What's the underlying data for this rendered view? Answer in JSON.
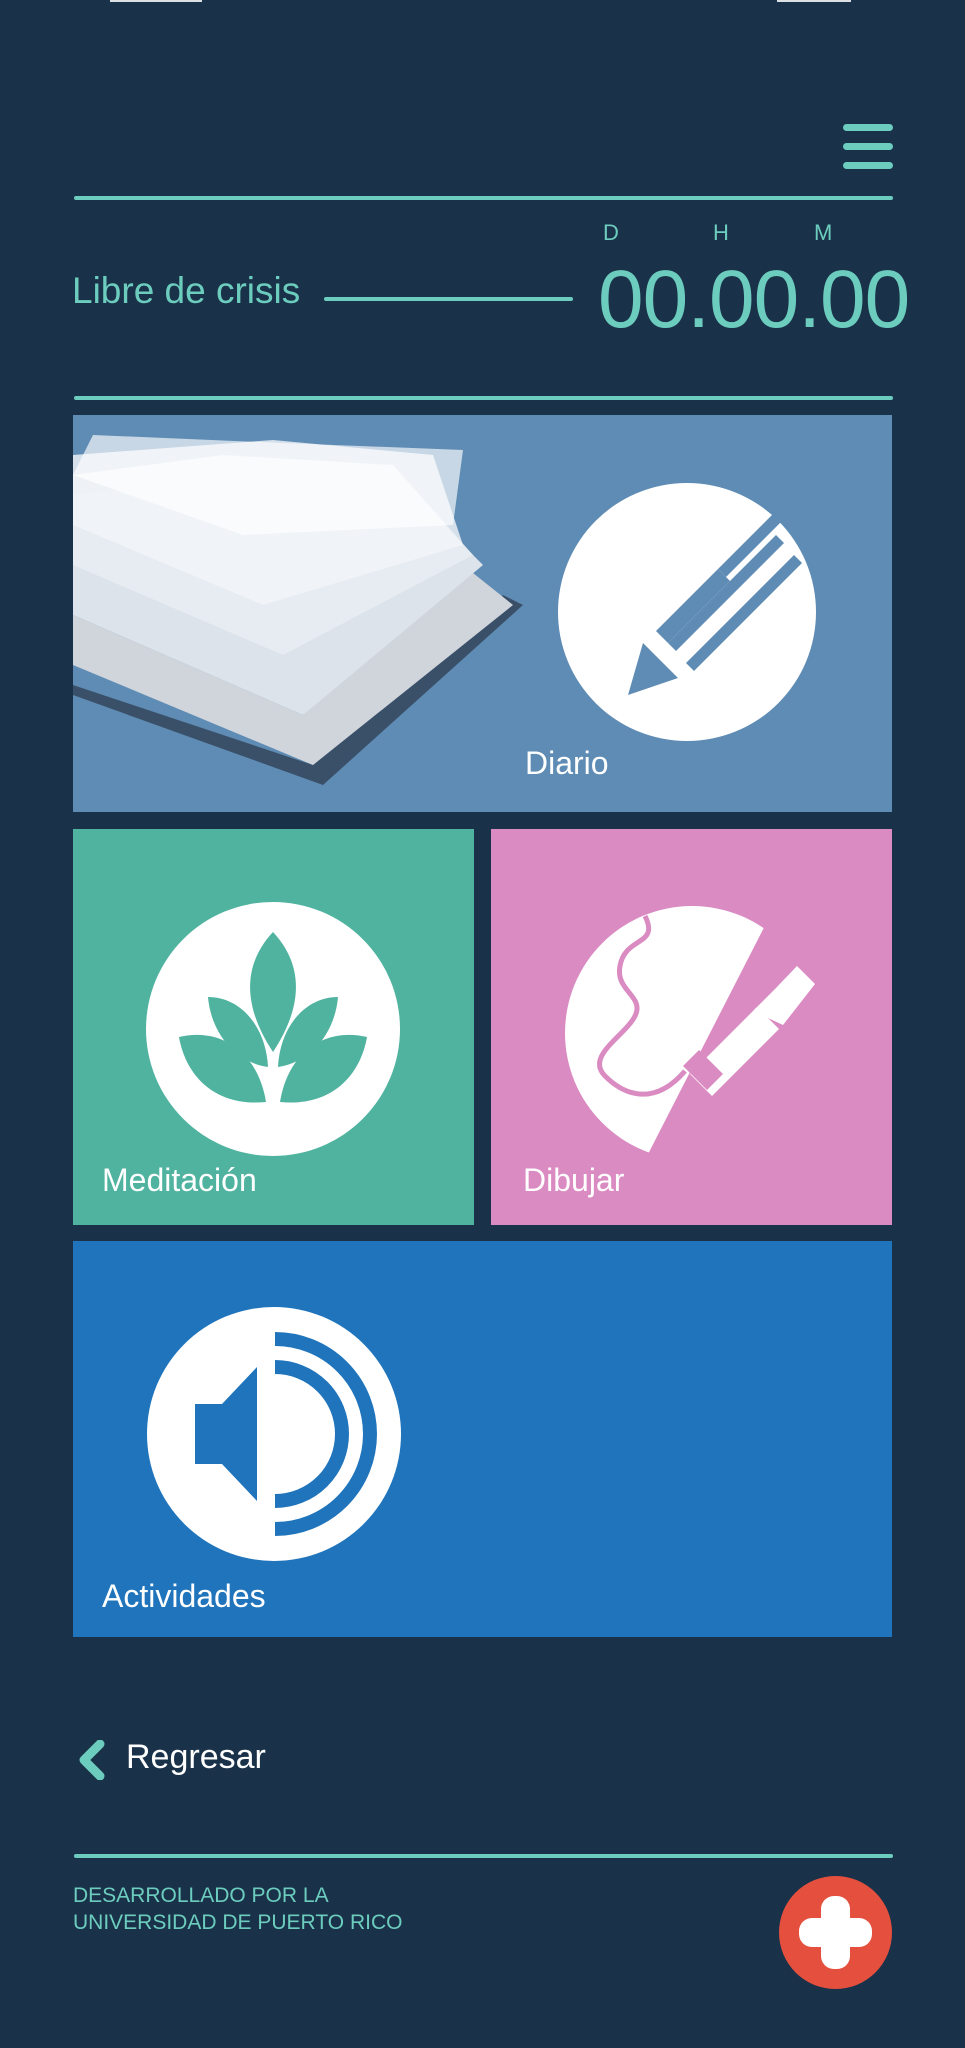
{
  "header": {
    "menu_icon": "hamburger-menu-icon"
  },
  "status": {
    "label": "Libre de crisis",
    "units": {
      "days": "D",
      "hours": "H",
      "minutes": "M"
    },
    "timer": "00.00.00"
  },
  "tiles": {
    "diary": {
      "label": "Diario",
      "color": "#5f8cb4",
      "icons": [
        "open-book-icon",
        "pencil-icon"
      ]
    },
    "meditation": {
      "label": "Meditación",
      "color": "#4fb39f",
      "icon": "lotus-icon"
    },
    "draw": {
      "label": "Dibujar",
      "color": "#da8bc2",
      "icon": "pen-cable-icon"
    },
    "activities": {
      "label": "Actividades",
      "color": "#1f74bc",
      "icon": "speaker-icon"
    }
  },
  "nav": {
    "back_label": "Regresar",
    "back_icon": "chevron-left-icon"
  },
  "footer": {
    "credit_line1": "DESARROLLADO POR LA",
    "credit_line2": "UNIVERSIDAD DE PUERTO RICO",
    "fab_icon": "plus-icon",
    "fab_color": "#e5503e"
  },
  "colors": {
    "background": "#1a3249",
    "accent": "#6ccdbf"
  }
}
